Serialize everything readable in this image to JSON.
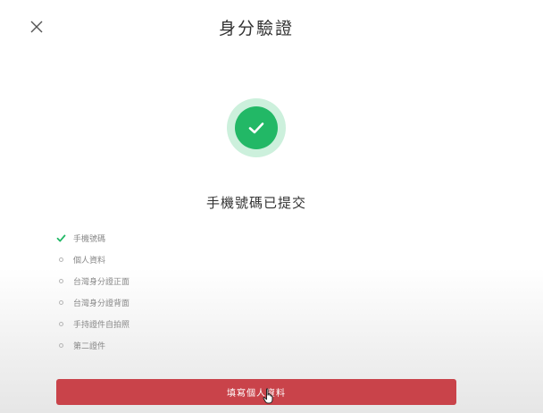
{
  "header": {
    "title": "身分驗證",
    "close_icon": "close-icon"
  },
  "status": {
    "icon": "check-circle-icon",
    "message": "手機號碼已提交"
  },
  "steps": [
    {
      "label": "手機號碼",
      "state": "done"
    },
    {
      "label": "個人資料",
      "state": "pending"
    },
    {
      "label": "台灣身分證正面",
      "state": "pending"
    },
    {
      "label": "台灣身分證背面",
      "state": "pending"
    },
    {
      "label": "手持證件自拍照",
      "state": "pending"
    },
    {
      "label": "第二證件",
      "state": "pending"
    }
  ],
  "action": {
    "label": "填寫個人資料"
  },
  "colors": {
    "success": "#22b866",
    "success_halo": "#ccf0dc",
    "primary_button": "#c9434a",
    "step_text": "#888888"
  }
}
